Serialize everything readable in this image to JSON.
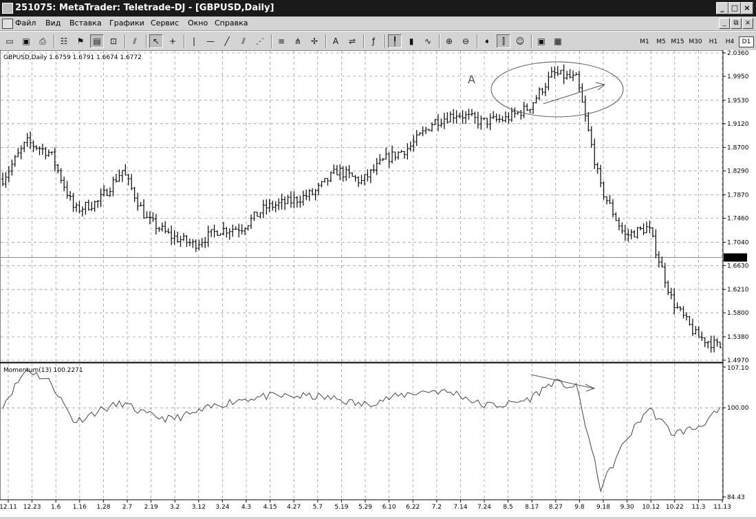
{
  "window": {
    "title": "251075: MetaTrader: Teletrade-DJ - [GBPUSD,Daily]",
    "controls": [
      "_",
      "□",
      "×"
    ]
  },
  "menu": {
    "items": [
      "Файл",
      "Вид",
      "Вставка",
      "Графики",
      "Сервис",
      "Окно",
      "Справка"
    ],
    "mdi_controls": [
      "_",
      "⧉",
      "×"
    ]
  },
  "toolbar": {
    "tools": [
      {
        "name": "new-chart-icon",
        "glyph": "▭"
      },
      {
        "name": "save-icon",
        "glyph": "▣"
      },
      {
        "name": "print-icon",
        "glyph": "⎙"
      },
      {
        "name": "sep"
      },
      {
        "name": "market-watch-icon",
        "glyph": "☷"
      },
      {
        "name": "navigator-icon",
        "glyph": "⚑"
      },
      {
        "name": "terminal-icon",
        "glyph": "▤",
        "pressed": true
      },
      {
        "name": "tester-icon",
        "glyph": "⊡"
      },
      {
        "name": "sep"
      },
      {
        "name": "expert-icon",
        "glyph": "⫽"
      },
      {
        "name": "sep"
      },
      {
        "name": "cursor-icon",
        "glyph": "↖",
        "pressed": true
      },
      {
        "name": "crosshair-icon",
        "glyph": "+"
      },
      {
        "name": "sep"
      },
      {
        "name": "vertical-line-icon",
        "glyph": "|"
      },
      {
        "name": "horizontal-line-icon",
        "glyph": "—"
      },
      {
        "name": "trendline-icon",
        "glyph": "╱"
      },
      {
        "name": "channel-icon",
        "glyph": "⫽"
      },
      {
        "name": "gann-fan-icon",
        "glyph": "⋰"
      },
      {
        "name": "sep"
      },
      {
        "name": "fibo-icon",
        "glyph": "≡"
      },
      {
        "name": "pitchfork-icon",
        "glyph": "⋔"
      },
      {
        "name": "cycle-lines-icon",
        "glyph": "✢"
      },
      {
        "name": "sep"
      },
      {
        "name": "text-icon",
        "glyph": "A"
      },
      {
        "name": "arrow-label-icon",
        "glyph": "⇌"
      },
      {
        "name": "sep"
      },
      {
        "name": "indicators-icon",
        "glyph": "ƒ"
      },
      {
        "name": "sep"
      },
      {
        "name": "bar-chart-icon",
        "glyph": "╿",
        "pressed": true
      },
      {
        "name": "candle-chart-icon",
        "glyph": "▮"
      },
      {
        "name": "line-chart-icon",
        "glyph": "∿"
      },
      {
        "name": "sep"
      },
      {
        "name": "zoom-in-icon",
        "glyph": "⊕"
      },
      {
        "name": "zoom-out-icon",
        "glyph": "⊖"
      },
      {
        "name": "sep"
      },
      {
        "name": "autoscroll-icon",
        "glyph": "➧"
      },
      {
        "name": "chart-shift-icon",
        "glyph": "⫿",
        "pressed": true
      },
      {
        "name": "expert-advisors-icon",
        "glyph": "☺"
      },
      {
        "name": "sep"
      },
      {
        "name": "periods-icon",
        "glyph": "▣"
      },
      {
        "name": "templates-icon",
        "glyph": "▦"
      }
    ],
    "timeframes": [
      "M1",
      "M5",
      "M15",
      "M30",
      "H1",
      "H4",
      "D1"
    ],
    "active_timeframe": "D1"
  },
  "chart": {
    "header": "GBPUSD,Daily  1.6759 1.6791 1.6674 1.6772",
    "annotation": "A",
    "current_price": "1.6772",
    "price_axis": [
      "2.0360",
      "1.9950",
      "1.9530",
      "1.9120",
      "1.8700",
      "1.8290",
      "1.7870",
      "1.7460",
      "1.7040",
      "1.6630",
      "1.6210",
      "1.5800",
      "1.5380",
      "1.4970"
    ],
    "indicator_header": "Momentum(13)  100.2271",
    "indicator_axis": [
      "107.10",
      "100.00",
      "84.43"
    ],
    "date_axis": [
      "12.11",
      "12.23",
      "1.6",
      "1.16",
      "1.28",
      "2.7",
      "2.19",
      "3.2",
      "3.12",
      "3.24",
      "4.3",
      "4.15",
      "4.27",
      "5.7",
      "5.19",
      "5.29",
      "6.10",
      "6.22",
      "7.2",
      "7.14",
      "7.24",
      "8.5",
      "8.17",
      "8.27",
      "9.8",
      "9.18",
      "9.30",
      "10.12",
      "10.22",
      "11.3",
      "11.13"
    ],
    "colors": {
      "price_bars": "#000000",
      "grid": "#9a9a9a",
      "annotation": "#555555"
    }
  },
  "chart_data": [
    {
      "type": "line",
      "title": "GBPUSD,Daily",
      "xlabel": "",
      "ylabel": "",
      "ylim": [
        1.497,
        2.036
      ],
      "x": [
        "12.11",
        "12.23",
        "1.6",
        "1.16",
        "1.28",
        "2.7",
        "2.19",
        "3.2",
        "3.12",
        "3.24",
        "4.3",
        "4.15",
        "4.27",
        "5.7",
        "5.19",
        "5.29",
        "6.10",
        "6.22",
        "7.2",
        "7.14",
        "7.24",
        "8.5",
        "8.17",
        "8.27",
        "9.8",
        "9.18",
        "9.30",
        "10.12",
        "10.22",
        "11.3",
        "11.13"
      ],
      "series": [
        {
          "values": [
            1.815,
            1.88,
            1.86,
            1.76,
            1.775,
            1.83,
            1.745,
            1.715,
            1.7,
            1.725,
            1.73,
            1.765,
            1.775,
            1.79,
            1.83,
            1.81,
            1.85,
            1.87,
            1.915,
            1.93,
            1.915,
            1.92,
            1.94,
            2.0,
            1.99,
            1.8,
            1.715,
            1.73,
            1.6,
            1.54,
            1.52
          ]
        }
      ]
    },
    {
      "type": "line",
      "title": "Momentum(13)",
      "xlabel": "",
      "ylabel": "",
      "ylim": [
        84.43,
        107.1
      ],
      "x": [
        "12.11",
        "12.23",
        "1.6",
        "1.16",
        "1.28",
        "2.7",
        "2.19",
        "3.2",
        "3.12",
        "3.24",
        "4.3",
        "4.15",
        "4.27",
        "5.7",
        "5.19",
        "5.29",
        "6.10",
        "6.22",
        "7.2",
        "7.14",
        "7.24",
        "8.5",
        "8.17",
        "8.27",
        "9.8",
        "9.18",
        "9.30",
        "10.12",
        "10.22",
        "11.3",
        "11.13"
      ],
      "series": [
        {
          "values": [
            100.5,
            106.8,
            104.5,
            97.5,
            99.5,
            100.8,
            98.8,
            98.0,
            99.0,
            100.5,
            101.5,
            102.0,
            102.0,
            102.0,
            101.5,
            100.5,
            101.5,
            102.5,
            103.0,
            102.5,
            100.5,
            100.5,
            101.5,
            104.5,
            103.5,
            86.0,
            94.0,
            100.0,
            95.5,
            96.5,
            99.5
          ]
        }
      ]
    }
  ]
}
